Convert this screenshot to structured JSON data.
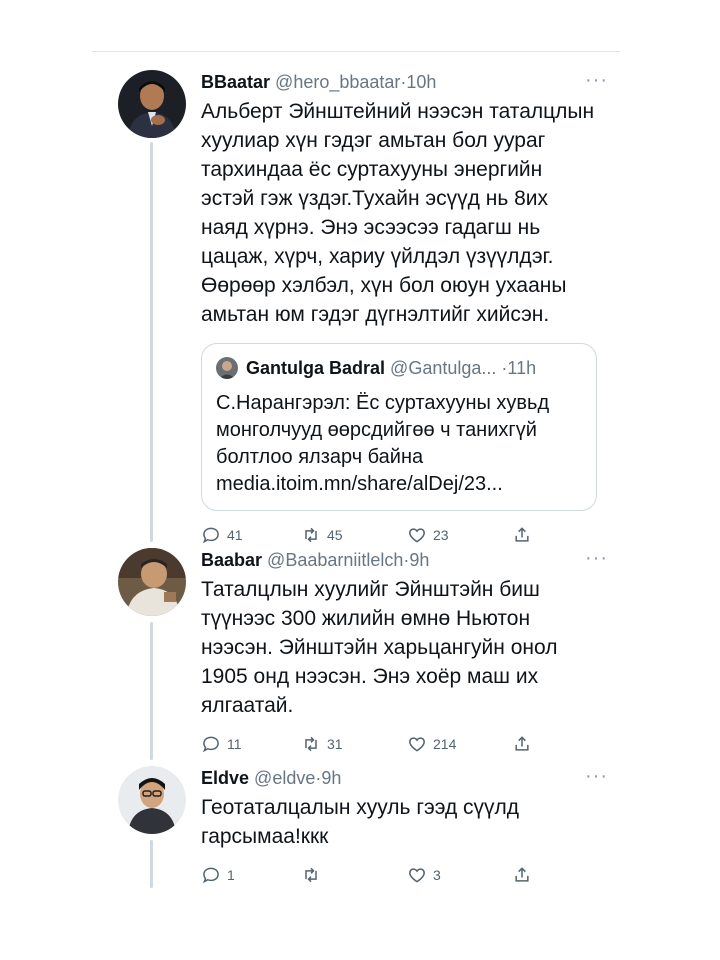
{
  "tweets": [
    {
      "name": "BBaatar",
      "handle": "@hero_bbaatar",
      "separator": "·",
      "time": "10h",
      "more": "···",
      "text": "Альберт Эйнштейний нээсэн таталцлын\nхуулиар хүн гэдэг амьтан бол уураг\nтархиндаа ёс суртахууны энергийн\nэстэй гэж үздэг.Тухайн эсүүд нь 8их\nнаяд хүрнэ. Энэ эсээсээ гадагш нь\nцацаж,  хүрч, хариу үйлдэл үзүүлдэг.\nӨөрөөр хэлбэл, хүн бол оюун ухааны\nамьтан юм гэдэг дүгнэлтийг хийсэн.",
      "quote": {
        "name": "Gantulga Badral",
        "handle": "@Gantulga...",
        "separator": "·",
        "time": "11h",
        "text": "С.Нарангэрэл: Ёс суртахууны хувьд\nмонголчууд өөрсдийгөө ч танихгүй\nболтлоо ялзарч байна\nmedia.itoim.mn/share/alDej/23..."
      },
      "replies": "41",
      "retweets": "45",
      "likes": "23"
    },
    {
      "name": "Baabar",
      "handle": "@Baabarniitlelch",
      "separator": "·",
      "time": "9h",
      "more": "···",
      "text": "Таталцлын хуулийг Эйнштэйн биш\nтүүнээс 300 жилийн өмнө Ньютон\nнээсэн. Эйнштэйн харьцангуйн онол\n1905 онд нээсэн. Энэ хоёр маш их\nялгаатай.",
      "replies": "11",
      "retweets": "31",
      "likes": "214"
    },
    {
      "name": "Eldve",
      "handle": "@eldve",
      "separator": "·",
      "time": "9h",
      "more": "···",
      "text": "Геотаталцалын хууль гээд сүүлд\nгарсымаа!ккк",
      "replies": "1",
      "retweets": "",
      "likes": "3"
    }
  ],
  "colors": {
    "text": "#0f1419",
    "secondary": "#687684",
    "border": "#cfd9de"
  }
}
